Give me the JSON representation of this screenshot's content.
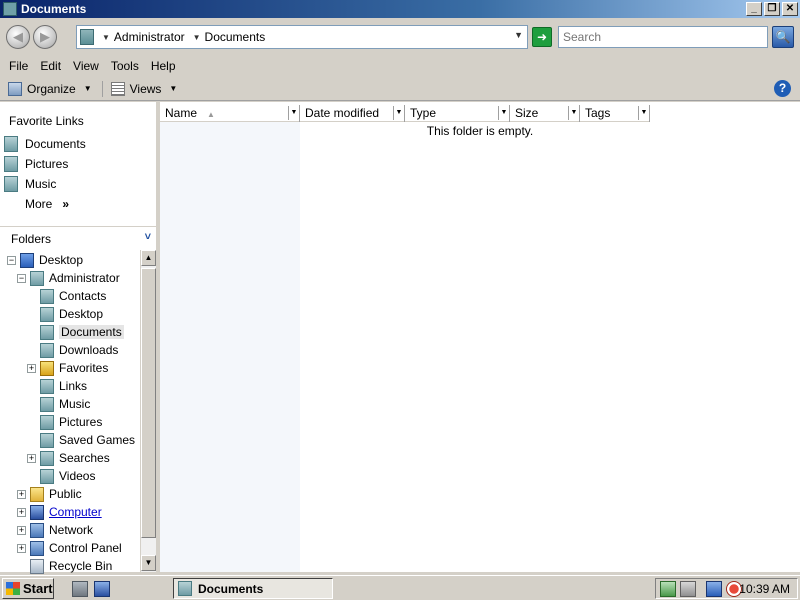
{
  "window": {
    "title": "Documents",
    "controls": [
      "_",
      "❐",
      "✕"
    ]
  },
  "nav": {
    "back_glyph": "◀",
    "forward_glyph": "▶",
    "breadcrumbs": [
      "Administrator",
      "Documents"
    ],
    "search_placeholder": "Search",
    "refresh_glyph": "➜",
    "search_glyph": "🔍"
  },
  "menu": [
    "File",
    "Edit",
    "View",
    "Tools",
    "Help"
  ],
  "toolbar": {
    "organize_label": "Organize",
    "views_label": "Views",
    "help_glyph": "?"
  },
  "favorites": {
    "title": "Favorite Links",
    "items": [
      {
        "label": "Documents",
        "icon": "documents-icon"
      },
      {
        "label": "Pictures",
        "icon": "pictures-icon"
      },
      {
        "label": "Music",
        "icon": "music-icon"
      }
    ],
    "more_label": "More",
    "more_glyph": "»"
  },
  "folders": {
    "title": "Folders",
    "collapse_glyph": "˅",
    "tree": [
      {
        "label": "Desktop",
        "expander": "−"
      },
      {
        "label": "Administrator",
        "expander": "−"
      },
      {
        "label": "Contacts",
        "expander": ""
      },
      {
        "label": "Desktop",
        "expander": ""
      },
      {
        "label": "Documents",
        "expander": ""
      },
      {
        "label": "Downloads",
        "expander": ""
      },
      {
        "label": "Favorites",
        "expander": "+"
      },
      {
        "label": "Links",
        "expander": ""
      },
      {
        "label": "Music",
        "expander": ""
      },
      {
        "label": "Pictures",
        "expander": ""
      },
      {
        "label": "Saved Games",
        "expander": ""
      },
      {
        "label": "Searches",
        "expander": "+"
      },
      {
        "label": "Videos",
        "expander": ""
      },
      {
        "label": "Public",
        "expander": "+"
      },
      {
        "label": "Computer",
        "expander": "+"
      },
      {
        "label": "Network",
        "expander": "+"
      },
      {
        "label": "Control Panel",
        "expander": "+"
      },
      {
        "label": "Recycle Bin",
        "expander": ""
      }
    ],
    "selected": "Documents"
  },
  "columns": [
    "Name",
    "Date modified",
    "Type",
    "Size",
    "Tags"
  ],
  "empty_message": "This folder is empty.",
  "taskbar": {
    "start_label": "Start",
    "active_window": "Documents",
    "clock": "10:39 AM"
  },
  "colors": {
    "titlebar": "#0a246a",
    "window_bg": "#d4d0c8",
    "link": "#0000cc"
  }
}
